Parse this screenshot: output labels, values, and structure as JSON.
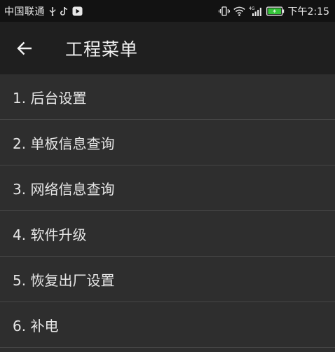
{
  "status_bar": {
    "carrier": "中国联通",
    "network_type": "4G",
    "time": "下午2:15",
    "icons": [
      "usb-icon",
      "tiktok-icon",
      "media-icon",
      "vibrate-icon",
      "wifi-icon",
      "signal-icon",
      "battery-icon"
    ]
  },
  "app_bar": {
    "title": "工程菜单",
    "back_icon": "arrow-left-icon"
  },
  "menu": {
    "items": [
      {
        "label": "1. 后台设置"
      },
      {
        "label": "2. 单板信息查询"
      },
      {
        "label": "3. 网络信息查询"
      },
      {
        "label": "4. 软件升级"
      },
      {
        "label": "5. 恢复出厂设置"
      },
      {
        "label": "6. 补电"
      }
    ]
  },
  "colors": {
    "status_bar_bg": "#121212",
    "app_bar_bg": "#1f1f1f",
    "list_bg": "#2e2e2e",
    "divider": "#464646",
    "battery_green": "#35c43a"
  }
}
